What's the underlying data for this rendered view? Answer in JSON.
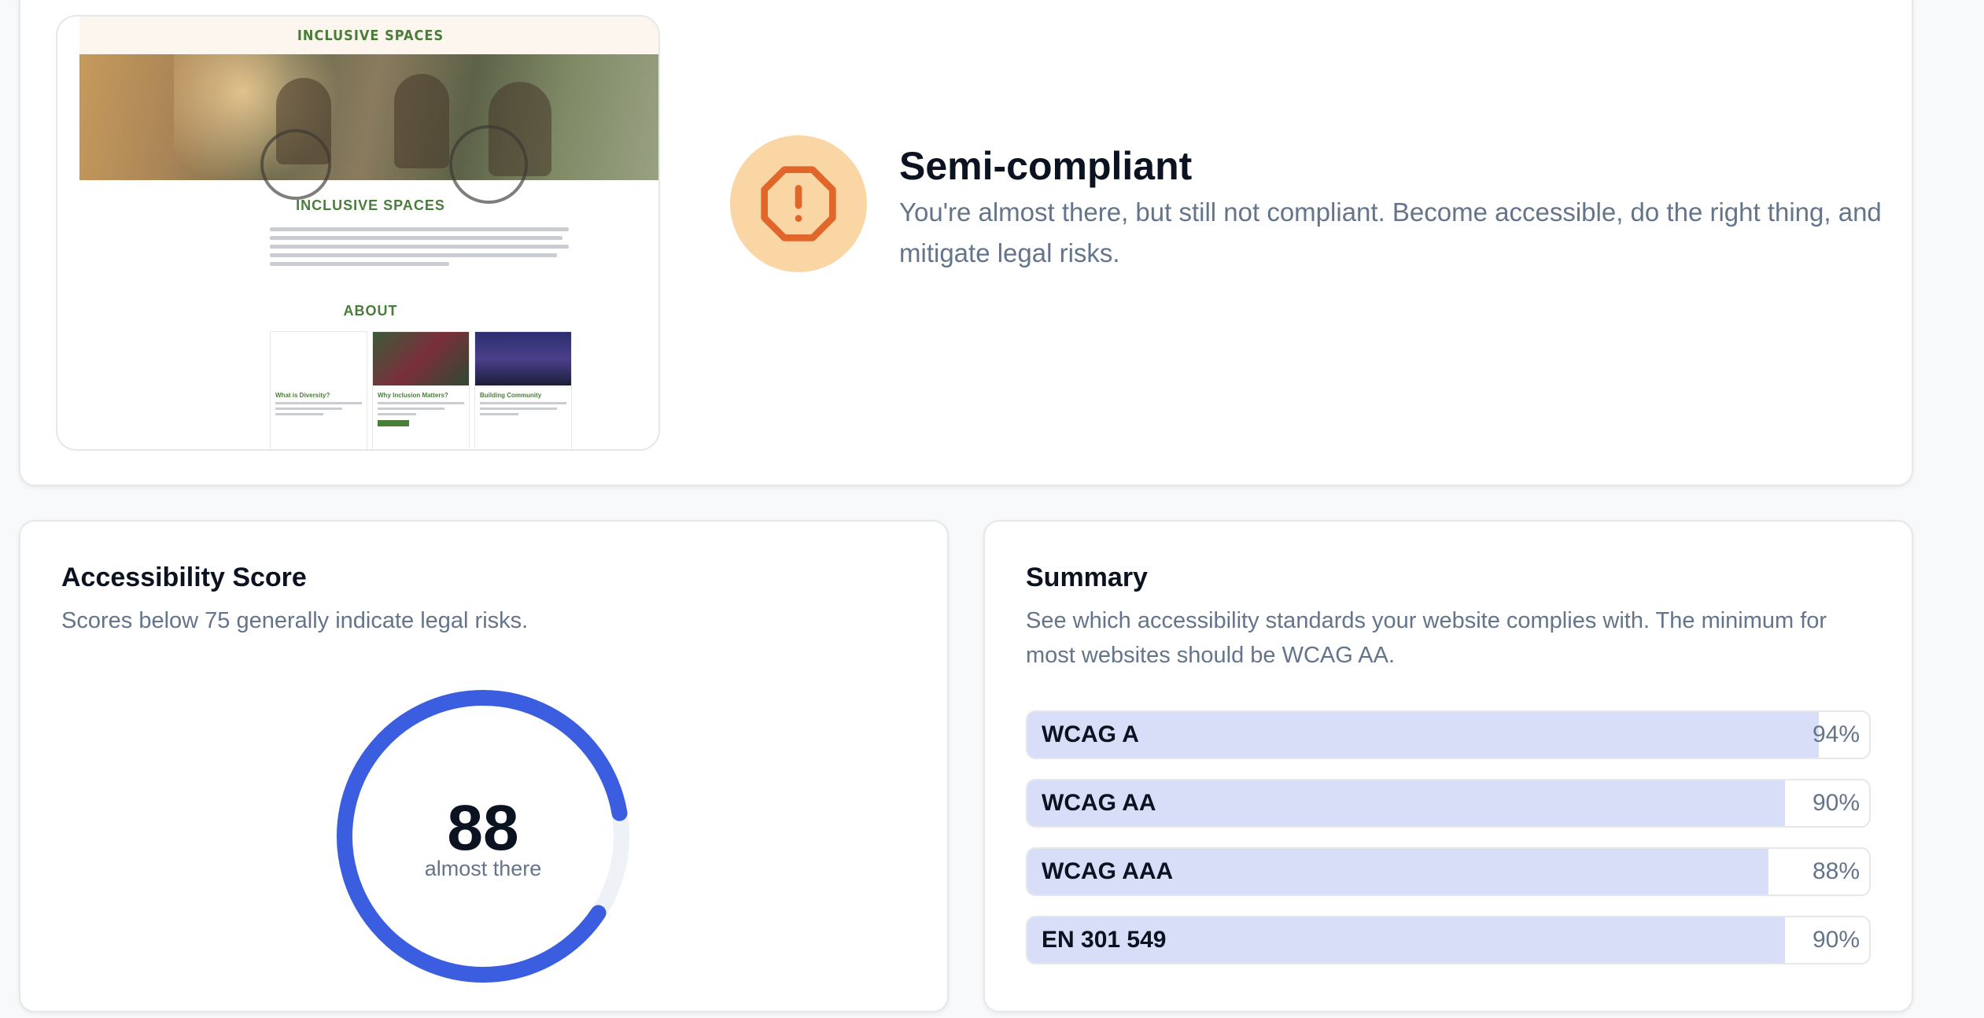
{
  "preview": {
    "header": "INCLUSIVE SPACES",
    "section_title": "INCLUSIVE SPACES",
    "about_title": "ABOUT",
    "columns": [
      {
        "heading": "What is Diversity?"
      },
      {
        "heading": "Why Inclusion Matters?"
      },
      {
        "heading": "Building Community"
      }
    ]
  },
  "status": {
    "icon": "alert-octagon-icon",
    "title": "Semi-compliant",
    "description": "You're almost there, but still not compliant. Become accessible, do the right thing, and mitigate legal risks."
  },
  "score_card": {
    "title": "Accessibility Score",
    "subtitle": "Scores below 75 generally indicate legal risks.",
    "score": 88,
    "score_text": "88",
    "label": "almost there",
    "accent": "#3b5ee0",
    "track": "#eef1f6"
  },
  "summary_card": {
    "title": "Summary",
    "subtitle": "See which accessibility standards your website complies with. The minimum for most websites should be WCAG AA.",
    "bars": [
      {
        "name": "WCAG A",
        "pct_text": "94%",
        "value": 94
      },
      {
        "name": "WCAG AA",
        "pct_text": "90%",
        "value": 90
      },
      {
        "name": "WCAG AAA",
        "pct_text": "88%",
        "value": 88
      },
      {
        "name": "EN 301 549",
        "pct_text": "90%",
        "value": 90
      }
    ]
  },
  "colors": {
    "status_bg": "#f9d6a4",
    "status_icon": "#e0662a",
    "bar_fill": "#d8def8"
  }
}
